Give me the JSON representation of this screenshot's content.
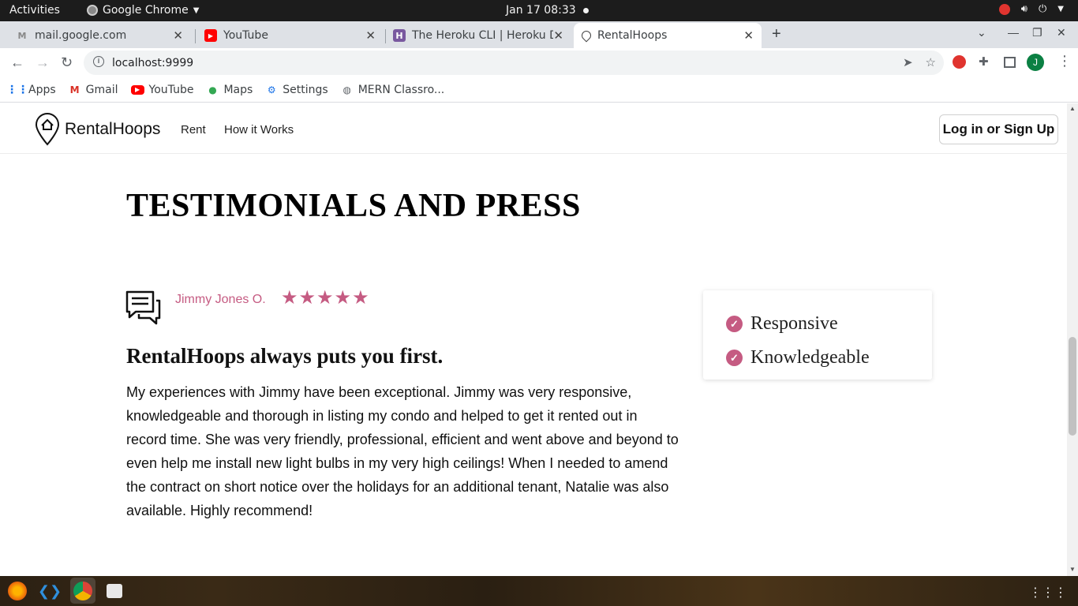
{
  "system_bar": {
    "activities": "Activities",
    "app_name": "Google Chrome",
    "clock": "Jan 17  08:33"
  },
  "tabs": [
    {
      "label": "mail.google.com",
      "icon": "gmail-icon"
    },
    {
      "label": "YouTube",
      "icon": "youtube-icon"
    },
    {
      "label": "The Heroku CLI | Heroku D",
      "icon": "heroku-icon"
    },
    {
      "label": "RentalHoops",
      "icon": "rentalhoops-icon",
      "active": true
    }
  ],
  "omnibox": {
    "url": "localhost:9999"
  },
  "bookmarks": [
    {
      "label": "Apps",
      "icon": "apps-grid-icon"
    },
    {
      "label": "Gmail",
      "icon": "gmail-icon"
    },
    {
      "label": "YouTube",
      "icon": "youtube-icon"
    },
    {
      "label": "Maps",
      "icon": "maps-pin-icon"
    },
    {
      "label": "Settings",
      "icon": "gear-icon"
    },
    {
      "label": "MERN Classro...",
      "icon": "globe-icon"
    }
  ],
  "site_nav": {
    "brand": "RentalHoops",
    "links": [
      "Rent",
      "How it Works"
    ],
    "login_label": "Log in or Sign Up"
  },
  "testimonials": {
    "section_title": "TESTIMONIALS AND PRESS",
    "author": "Jimmy Jones O.",
    "rating": 5,
    "headline": "RentalHoops always puts you first.",
    "body": "My experiences with Jimmy have been exceptional. Jimmy was very responsive, knowledgeable and thorough in listing my condo and helped to get it rented out in record time. She was very friendly, professional, efficient and went above and beyond to even help me install new light bulbs in my very high ceilings! When I needed to amend the contract on short notice over the holidays for an additional tenant, Natalie was also available. Highly recommend!",
    "qualities": [
      "Responsive",
      "Knowledgeable"
    ]
  },
  "colors": {
    "accent": "#c55b82",
    "chrome_tabstrip": "#dee1e6",
    "system_bar": "#1c1c1c"
  }
}
